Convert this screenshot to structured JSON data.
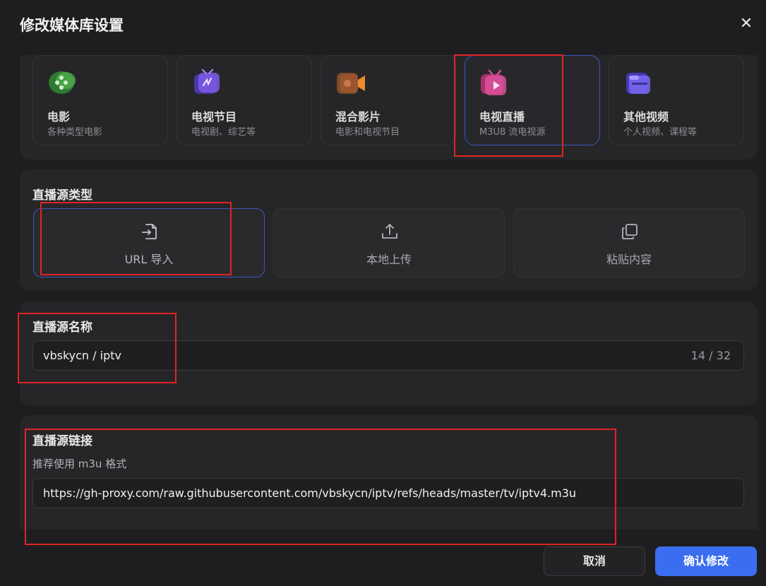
{
  "dialog": {
    "title": "修改媒体库设置",
    "close_label": "✕"
  },
  "media_types": [
    {
      "name": "电影",
      "desc": "各种类型电影",
      "icon": "film-icon",
      "color": "#3c9a3a"
    },
    {
      "name": "电视节目",
      "desc": "电视剧、综艺等",
      "icon": "tv-icon",
      "color": "#6a4bd6"
    },
    {
      "name": "混合影片",
      "desc": "电影和电视节目",
      "icon": "camera-icon",
      "color": "#e07a2a"
    },
    {
      "name": "电视直播",
      "desc": "M3U8 流电视源",
      "icon": "live-tv-icon",
      "color": "#d8459a",
      "selected": true
    },
    {
      "name": "其他视频",
      "desc": "个人视频、课程等",
      "icon": "folder-icon",
      "color": "#6d5ee8"
    }
  ],
  "source_type": {
    "label": "直播源类型",
    "options": [
      {
        "label": "URL 导入",
        "icon": "import-file-icon",
        "selected": true
      },
      {
        "label": "本地上传",
        "icon": "upload-icon"
      },
      {
        "label": "粘贴内容",
        "icon": "copy-icon"
      }
    ]
  },
  "source_name": {
    "label": "直播源名称",
    "value": "vbskycn / iptv",
    "counter": "14 / 32"
  },
  "source_link": {
    "label": "直播源链接",
    "hint": "推荐使用 m3u 格式",
    "value": "https://gh-proxy.com/raw.githubusercontent.com/vbskycn/iptv/refs/heads/master/tv/iptv4.m3u"
  },
  "footer": {
    "cancel_label": "取消",
    "confirm_label": "确认修改"
  },
  "colors": {
    "accent": "#3a6df0",
    "selected_border": "#3b56c4",
    "highlight": "#e02424"
  }
}
